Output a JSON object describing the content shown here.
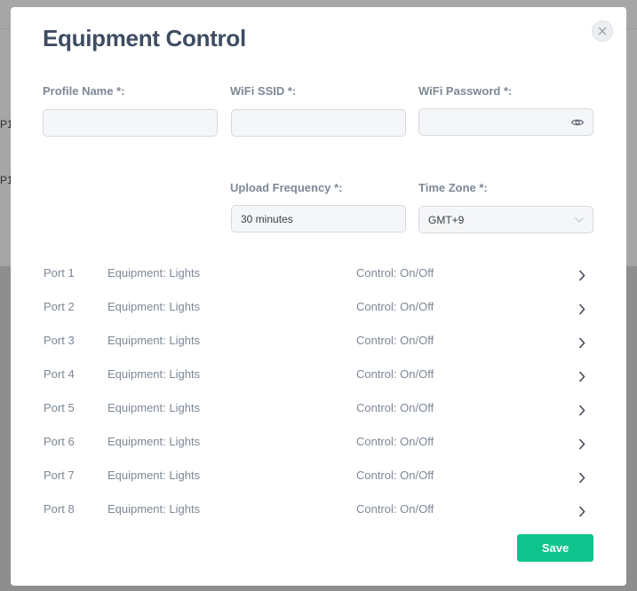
{
  "background": {
    "row1_text": "P1",
    "row2_text": "P1"
  },
  "modal": {
    "title": "Equipment Control",
    "close_symbol": "×",
    "fields": {
      "profile_name": {
        "label": "Profile Name *:",
        "value": ""
      },
      "wifi_ssid": {
        "label": "WiFi SSID *:",
        "value": ""
      },
      "wifi_password": {
        "label": "WiFi Password *:",
        "value": ""
      },
      "upload_frequency": {
        "label": "Upload Frequency *:",
        "value": "30 minutes"
      },
      "time_zone": {
        "label": "Time Zone *:",
        "value": "GMT+9"
      }
    },
    "ports": [
      {
        "port": "Port 1",
        "equipment": "Equipment: Lights",
        "control": "Control: On/Off"
      },
      {
        "port": "Port 2",
        "equipment": "Equipment: Lights",
        "control": "Control: On/Off"
      },
      {
        "port": "Port 3",
        "equipment": "Equipment: Lights",
        "control": "Control: On/Off"
      },
      {
        "port": "Port 4",
        "equipment": "Equipment: Lights",
        "control": "Control: On/Off"
      },
      {
        "port": "Port 5",
        "equipment": "Equipment: Lights",
        "control": "Control: On/Off"
      },
      {
        "port": "Port 6",
        "equipment": "Equipment: Lights",
        "control": "Control: On/Off"
      },
      {
        "port": "Port 7",
        "equipment": "Equipment: Lights",
        "control": "Control: On/Off"
      },
      {
        "port": "Port 8",
        "equipment": "Equipment: Lights",
        "control": "Control: On/Off"
      }
    ],
    "save_label": "Save"
  },
  "icons": {
    "close": "close-icon",
    "password_visibility": "eye-icon",
    "select_arrow": "chevron-down-icon",
    "row_arrow": "chevron-right-icon"
  },
  "colors": {
    "accent": "#0ec48c",
    "title": "#3f4d62",
    "label": "#7d8896",
    "overlay": "#8e8e8e"
  }
}
